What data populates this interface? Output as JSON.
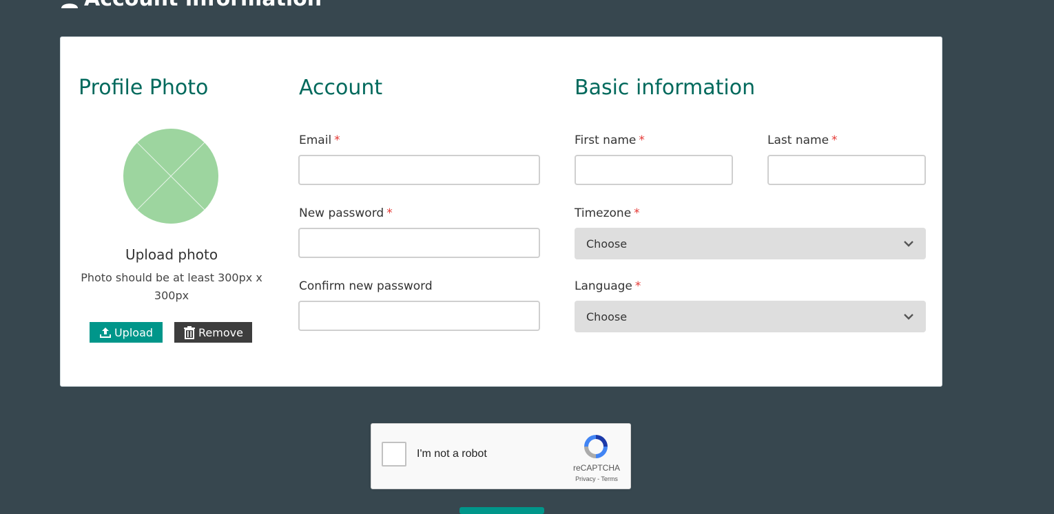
{
  "page": {
    "heading": "Account information"
  },
  "profile": {
    "title": "Profile Photo",
    "upload_title": "Upload photo",
    "upload_hint": "Photo should be at least 300px x 300px",
    "upload_button": "Upload",
    "remove_button": "Remove"
  },
  "account": {
    "title": "Account",
    "email_label": "Email",
    "new_password_label": "New password",
    "confirm_password_label": "Confirm new password",
    "required_mark": "*"
  },
  "basic": {
    "title": "Basic information",
    "first_name_label": "First name",
    "last_name_label": "Last name",
    "timezone_label": "Timezone",
    "timezone_value": "Choose",
    "language_label": "Language",
    "language_value": "Choose"
  },
  "recaptcha": {
    "label": "I'm not a robot",
    "brand": "reCAPTCHA",
    "links": "Privacy - Terms"
  },
  "colors": {
    "background": "#37474f",
    "accent": "#00695c",
    "button_primary": "#00968a",
    "button_dark": "#3d3d3d",
    "required": "#e53935"
  }
}
